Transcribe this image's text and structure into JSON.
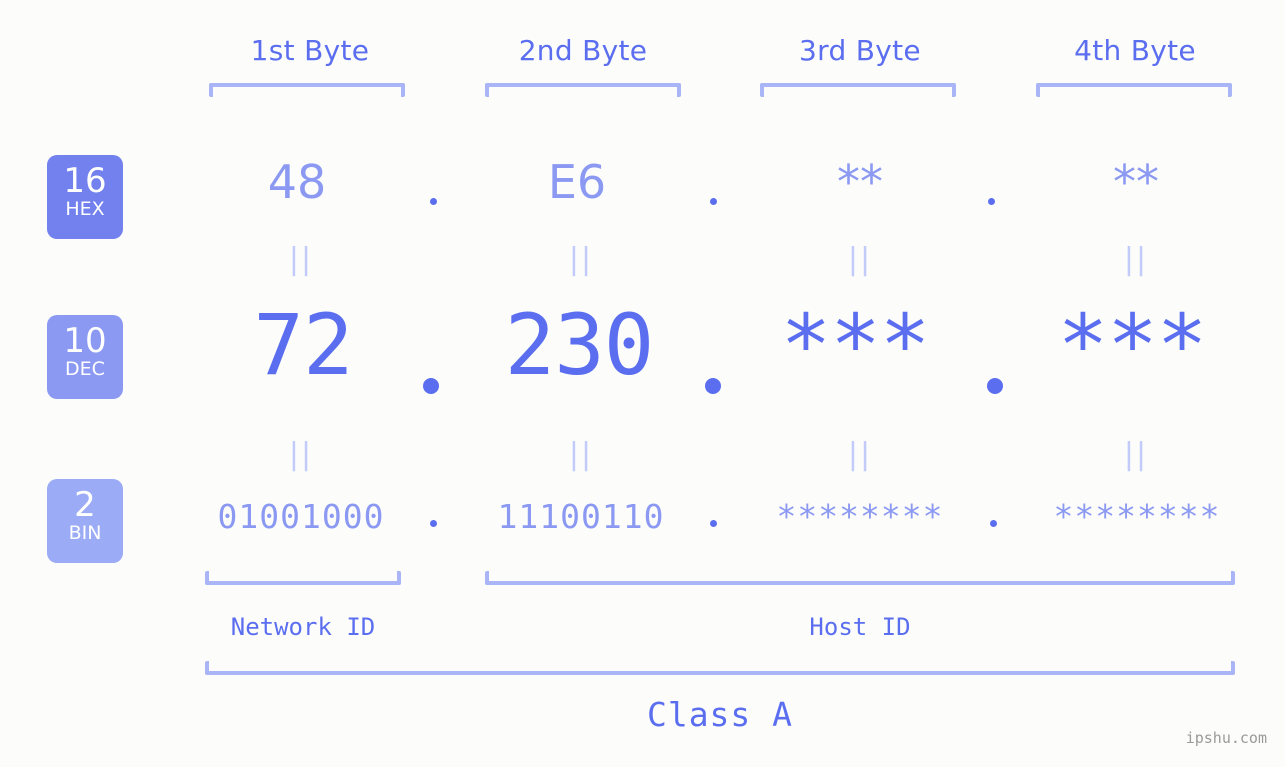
{
  "background_color": "#fcfdfa",
  "colors": {
    "accent_strong": "#5b6ef0",
    "accent_mid": "#8b99f2",
    "accent_light": "#aab5f7",
    "equals": "#c3cbfa",
    "badge_hex": "#7281ee",
    "badge_dec": "#8b99f2",
    "badge_bin": "#9babf6",
    "watermark": "#9a9a9a"
  },
  "header": {
    "byte_labels": [
      {
        "text": "1st Byte"
      },
      {
        "text": "2nd Byte"
      },
      {
        "text": "3rd Byte"
      },
      {
        "text": "4th Byte"
      }
    ]
  },
  "bases": [
    {
      "id": "hex",
      "number": "16",
      "abbr": "HEX"
    },
    {
      "id": "dec",
      "number": "10",
      "abbr": "DEC"
    },
    {
      "id": "bin",
      "number": "2",
      "abbr": "BIN"
    }
  ],
  "rows": {
    "hex": {
      "octets": [
        "48",
        "E6",
        "**",
        "**"
      ]
    },
    "dec": {
      "octets": [
        "72",
        "230",
        "***",
        "***"
      ]
    },
    "bin": {
      "octets": [
        "01001000",
        "11100110",
        "********",
        "********"
      ]
    }
  },
  "separators": {
    "dot": ".",
    "equals": "||"
  },
  "footer": {
    "network_id_label": "Network ID",
    "host_id_label": "Host ID",
    "class_label": "Class A"
  },
  "watermark": {
    "text": "ipshu.com"
  }
}
